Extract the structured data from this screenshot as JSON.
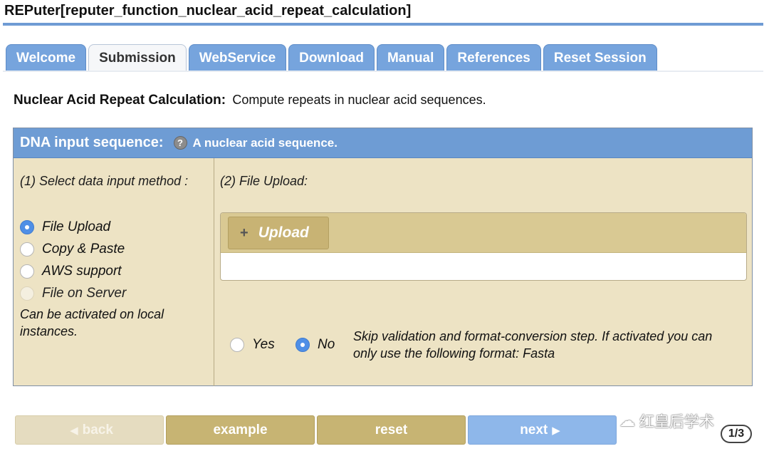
{
  "app": {
    "title": "REPuter[reputer_function_nuclear_acid_repeat_calculation]"
  },
  "tabs": [
    {
      "label": "Welcome",
      "active": false
    },
    {
      "label": "Submission",
      "active": true
    },
    {
      "label": "WebService",
      "active": false
    },
    {
      "label": "Download",
      "active": false
    },
    {
      "label": "Manual",
      "active": false
    },
    {
      "label": "References",
      "active": false
    },
    {
      "label": "Reset Session",
      "active": false
    }
  ],
  "page": {
    "heading": "Nuclear Acid Repeat Calculation:",
    "description": "Compute repeats in nuclear acid sequences."
  },
  "panel": {
    "title": "DNA input sequence:",
    "help_icon": "?",
    "description": "A nuclear acid sequence.",
    "step1_label": "(1) Select data input method :",
    "input_methods": [
      {
        "label": "File Upload",
        "checked": true,
        "disabled": false
      },
      {
        "label": "Copy & Paste",
        "checked": false,
        "disabled": false
      },
      {
        "label": "AWS support",
        "checked": false,
        "disabled": false
      },
      {
        "label": "File on Server",
        "checked": false,
        "disabled": true
      }
    ],
    "server_note": "Can be activated on local instances.",
    "step2_label": "(2) File Upload:",
    "upload_button": "Upload",
    "upload_icon": "+",
    "skip_validation": {
      "yes_label": "Yes",
      "no_label": "No",
      "selected": "No",
      "description": "Skip validation and format-conversion step. If activated you can only use the following format: Fasta"
    }
  },
  "buttons": {
    "back": "back",
    "example": "example",
    "reset": "reset",
    "next": "next",
    "back_arrow": "◀",
    "next_arrow": "▶"
  },
  "overlay": {
    "watermark": "红皇后学术",
    "page_counter": "1/3"
  },
  "colors": {
    "tab_blue": "#76a4dd",
    "panel_bg": "#ede3c4",
    "olive_button": "#c7b473",
    "next_button": "#8eb7ea",
    "radio_checked": "#4f8fe6"
  }
}
